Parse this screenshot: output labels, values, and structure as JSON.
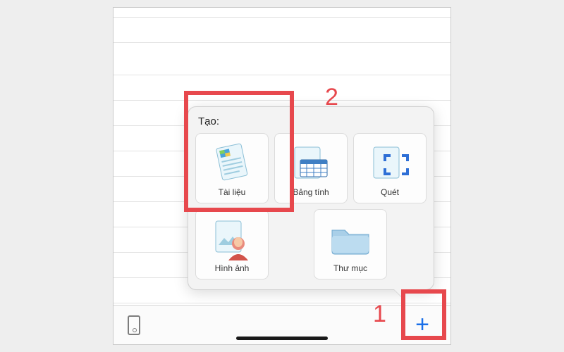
{
  "popover": {
    "title": "Tạo:",
    "tiles": [
      {
        "id": "document",
        "label": "Tài liệu"
      },
      {
        "id": "spreadsheet",
        "label": "Bảng tính"
      },
      {
        "id": "scan",
        "label": "Quét"
      },
      {
        "id": "image",
        "label": "Hình ảnh"
      },
      {
        "id": "folder",
        "label": "Thư mục"
      }
    ]
  },
  "toolbar": {
    "add_glyph": "+"
  },
  "annotations": {
    "step1": "1",
    "step2": "2"
  }
}
